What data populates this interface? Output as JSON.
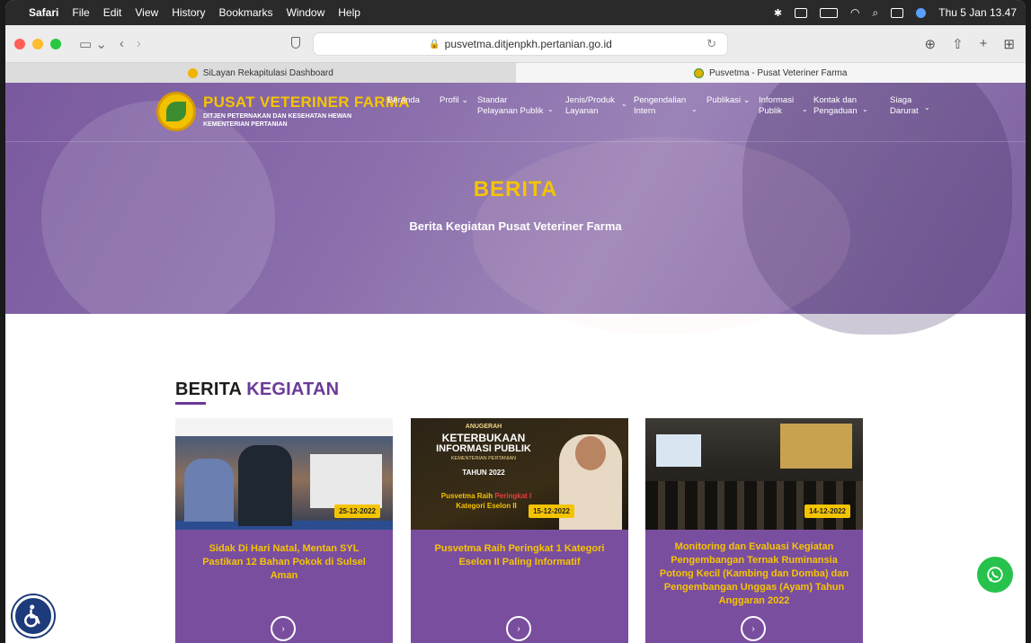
{
  "menubar": {
    "app": "Safari",
    "items": [
      "File",
      "Edit",
      "View",
      "History",
      "Bookmarks",
      "Window",
      "Help"
    ],
    "clock": "Thu 5 Jan  13.47"
  },
  "browser": {
    "url": "pusvetma.ditjenpkh.pertanian.go.id",
    "tabs": [
      {
        "label": "SiLayan Rekapitulasi Dashboard",
        "active": false
      },
      {
        "label": "Pusvetma - Pusat Veteriner Farma",
        "active": true
      }
    ]
  },
  "site": {
    "brand_title": "PUSAT VETERINER FARMA",
    "brand_sub1": "DITJEN PETERNAKAN DAN KESEHATAN HEWAN",
    "brand_sub2": "KEMENTERIAN PERTANIAN",
    "nav": [
      {
        "label": "Beranda",
        "l2": ""
      },
      {
        "label": "Profil",
        "l2": ""
      },
      {
        "label": "Standar",
        "l2": "Pelayanan Publik"
      },
      {
        "label": "Jenis/Produk",
        "l2": "Layanan"
      },
      {
        "label": "Pengendalian",
        "l2": "Intern"
      },
      {
        "label": "Publikasi",
        "l2": ""
      },
      {
        "label": "Informasi",
        "l2": "Publik"
      },
      {
        "label": "Kontak dan",
        "l2": "Pengaduan"
      },
      {
        "label": "Siaga",
        "l2": "Darurat"
      }
    ]
  },
  "hero": {
    "title": "BERITA",
    "subtitle": "Berita Kegiatan Pusat Veteriner Farma"
  },
  "section": {
    "title_a": "BERITA",
    "title_b": "KEGIATAN"
  },
  "cards": [
    {
      "date": "25-12-2022",
      "title": "Sidak Di Hari Natal, Mentan SYL Pastikan 12 Bahan Pokok di Sulsel Aman"
    },
    {
      "date": "15-12-2022",
      "title": "Pusvetma Raih Peringkat 1 Kategori Eselon II Paling Informatif",
      "img_text": {
        "l1": "ANUGERAH",
        "l2": "KETERBUKAAN",
        "l3": "INFORMASI PUBLIK",
        "l4": "KEMENTERIAN PERTANIAN",
        "l5": "TAHUN 2022",
        "l6a": "Pusvetma Raih",
        "l6b": "Peringkat I",
        "l7": "Kategori Eselon II"
      }
    },
    {
      "date": "14-12-2022",
      "title": "Monitoring dan Evaluasi Kegiatan Pengembangan Ternak Ruminansia Potong Kecil (Kambing dan Domba) dan Pengembangan Unggas (Ayam) Tahun Anggaran 2022"
    }
  ],
  "colors": {
    "purple": "#7a4e9f",
    "gold": "#f5c400",
    "whatsapp": "#27c24c"
  }
}
